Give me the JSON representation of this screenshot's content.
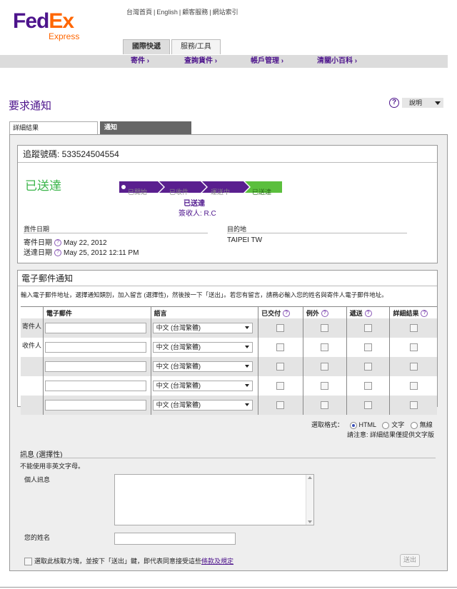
{
  "brand": {
    "fed": "Fed",
    "ex": "Ex",
    "sub": "Express",
    "purple": "#4d148c",
    "orange": "#ff6600"
  },
  "top_links": [
    "台灣首頁",
    "English",
    "顧客服務",
    "網站索引"
  ],
  "main_tabs": [
    {
      "label": "國際快遞",
      "active": true
    },
    {
      "label": "服務/工具",
      "active": false
    }
  ],
  "nav": [
    "寄件 ›",
    "查詢貨件 ›",
    "帳戶管理 ›",
    "清關小百科 ›"
  ],
  "page_title": "要求通知",
  "help_label": "說明",
  "sub_tabs": [
    "詳細結果",
    "通知"
  ],
  "tracking": {
    "header": "追蹤號碼: 533524504554",
    "status": "已送達",
    "progress_steps": [
      "已開始",
      "已收件",
      "運送中",
      "已送達"
    ],
    "status_bold": "已送達",
    "signed_by": "簽收人: R.C",
    "dates_label": "貨件日期",
    "ship_label": "寄件日期",
    "ship_value": "May 22, 2012",
    "delivery_label": "送達日期",
    "delivery_value": "May 25, 2012 12:11 PM",
    "dest_label": "目的地",
    "dest_value": "TAIPEI TW"
  },
  "email": {
    "header": "電子郵件通知",
    "instructions": "輸入電子郵件地址，選擇通知類別，加入留言 (選擇性)，然後按一下「送出」。若您有留言，請務必輸入您的姓名與寄件人電子郵件地址。",
    "columns": [
      "電子郵件",
      "語言",
      "已交付",
      "例外",
      "遞送",
      "詳細結果"
    ],
    "row_labels": [
      "寄件人",
      "收件人",
      "",
      "",
      ""
    ],
    "language_value": "中文 (台灣繁體)"
  },
  "format": {
    "label": "選取格式：",
    "options": [
      "HTML",
      "文字",
      "無線"
    ],
    "selected": "HTML",
    "note": "請注意: 詳細結果僅提供文字版"
  },
  "message": {
    "header": "訊息 (選擇性)",
    "sub": "不能使用非英文字母。",
    "personal_label": "個人訊息",
    "name_label": "您的姓名",
    "agree_text": "選取此核取方塊，並按下「送出」鍵，即代表同意接受這些",
    "agree_link": "條款及規定",
    "submit": "送出"
  }
}
